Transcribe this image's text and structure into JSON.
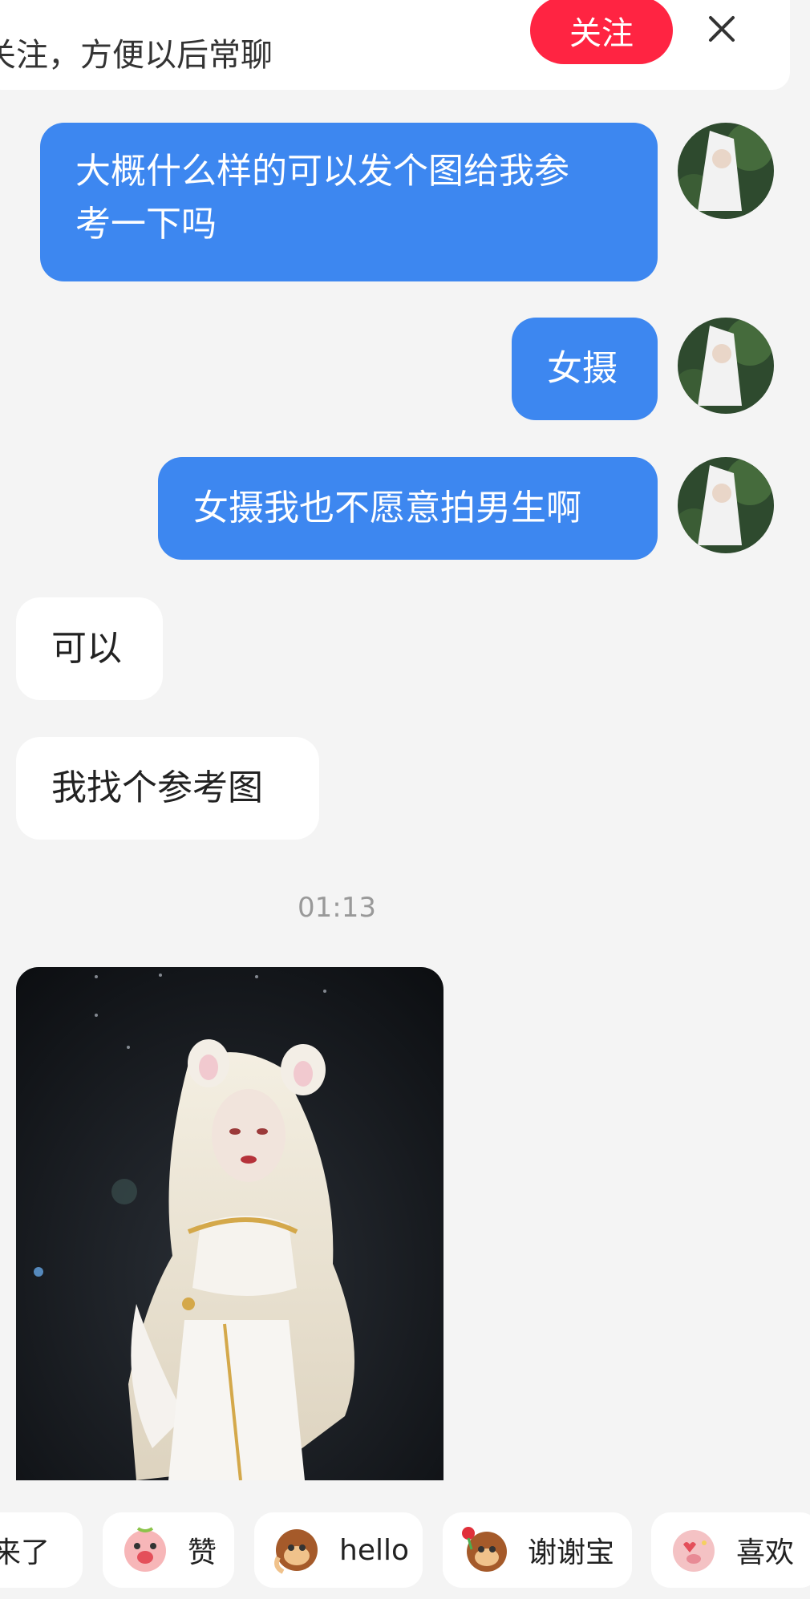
{
  "follow_banner": {
    "text": "关注，方便以后常聊",
    "follow_label": "关注"
  },
  "messages": {
    "m1": "大概什么样的可以发个图给我参",
    "m1b": "考一下吗",
    "m2": "女摄",
    "m3": "女摄我也不愿意拍男生啊",
    "m4": "可以",
    "m5": "我找个参考图"
  },
  "timestamp": "01:13",
  "quick_replies": [
    "来了",
    "赞",
    "hello",
    "谢谢宝",
    "喜欢"
  ],
  "colors": {
    "outgoing_bubble": "#3d87f0",
    "follow_button": "#ff2442",
    "background": "#f4f4f4"
  }
}
